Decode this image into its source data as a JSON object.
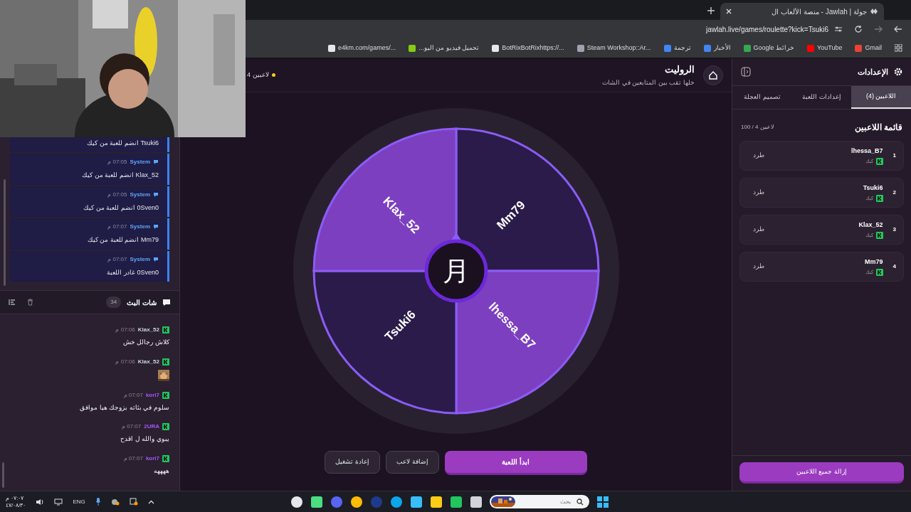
{
  "browser": {
    "tab_title": "جولة | Jawlah - منصة الألعاب ال",
    "url": "jawlah.live/games/roulette?kick=Tsuki6",
    "bookmarks": [
      "Gmail",
      "YouTube",
      "خرائط Google",
      "الأخبار",
      "ترجمة",
      "Steam Workshop::Ar...",
      "BotRixBotRixhttps://...",
      "تحميل فيديو من اليو...",
      "e4km.com/games/..."
    ]
  },
  "system_messages": [
    {
      "text": "Tsuki6 انضم للعبة من كيك"
    },
    {
      "sender": "System",
      "time": "07:05 م",
      "text": "Klax_52 انضم للعبة من كيك"
    },
    {
      "sender": "System",
      "time": "07:05 م",
      "text": "0Sven0 انضم للعبة من كيك"
    },
    {
      "sender": "System",
      "time": "07:07 م",
      "text": "Mm79 انضم للعبة من كيك"
    },
    {
      "sender": "System",
      "time": "07:07 م",
      "text": "0Sven0 غادر اللعبة"
    }
  ],
  "chat": {
    "title": "شات البث",
    "count": "34",
    "messages": [
      {
        "kind": "text",
        "user": "Klax_52",
        "color": "#c9d2e6",
        "time": "07:06 م",
        "text": "كلاش رجالل خش"
      },
      {
        "kind": "sticker",
        "user": "Klax_52",
        "color": "#c9d2e6",
        "time": "07:06 م"
      },
      {
        "kind": "text",
        "user": "kori7",
        "color": "#a855f7",
        "time": "07:07 م",
        "text": "سلوم في بثاته بزوجك هيا موافق"
      },
      {
        "kind": "text",
        "user": "2URA",
        "color": "#a855f7",
        "time": "07:07 م",
        "text": "يبوي والله ل اقدح"
      },
      {
        "kind": "text",
        "user": "kori7",
        "color": "#a855f7",
        "time": "07:07 م",
        "text": "ههههه"
      }
    ]
  },
  "game": {
    "title": "الروليت",
    "subtitle": "خلها تقب بين المتابعين في الشات",
    "players_badge": "4 لاعبين",
    "center_glyph": "月",
    "segments": [
      {
        "label": "Mm79",
        "color": "#2a1b4a"
      },
      {
        "label": "lhessa_B7",
        "color": "#7c3fc0"
      },
      {
        "label": "Tsuki6",
        "color": "#2a1b4a"
      },
      {
        "label": "Klax_52",
        "color": "#7c3fc0"
      }
    ],
    "buttons": [
      {
        "label": "ابدأ اللعبة",
        "kind": "primary"
      },
      {
        "label": "إضافة لاعب",
        "kind": "secondary"
      },
      {
        "label": "إعادة تشغيل",
        "kind": "secondary"
      }
    ]
  },
  "settings": {
    "title": "الإعدادات",
    "tabs": [
      {
        "label": "اللاعبين (4)",
        "selected": true
      },
      {
        "label": "إعدادات اللعبة",
        "selected": false
      },
      {
        "label": "تصميم العجلة",
        "selected": false
      }
    ],
    "list_title": "قائمة اللاعبين",
    "list_count": "100 / 4 لاعبين",
    "players": [
      {
        "number": "1",
        "name": "lhessa_B7",
        "platform": "كيك",
        "action": "طرد"
      },
      {
        "number": "2",
        "name": "Tsuki6",
        "platform": "كيك",
        "action": "طرد"
      },
      {
        "number": "3",
        "name": "Klax_52",
        "platform": "كيك",
        "action": "طرد"
      },
      {
        "number": "4",
        "name": "Mm79",
        "platform": "كيك",
        "action": "طرد"
      }
    ],
    "clear_button": "إزالة جميع اللاعبين"
  },
  "taskbar": {
    "search_placeholder": "بحث",
    "language": "ENG",
    "time": "٠٧:٠٧ م",
    "date": "٤٧/٠٨/٣٠"
  }
}
